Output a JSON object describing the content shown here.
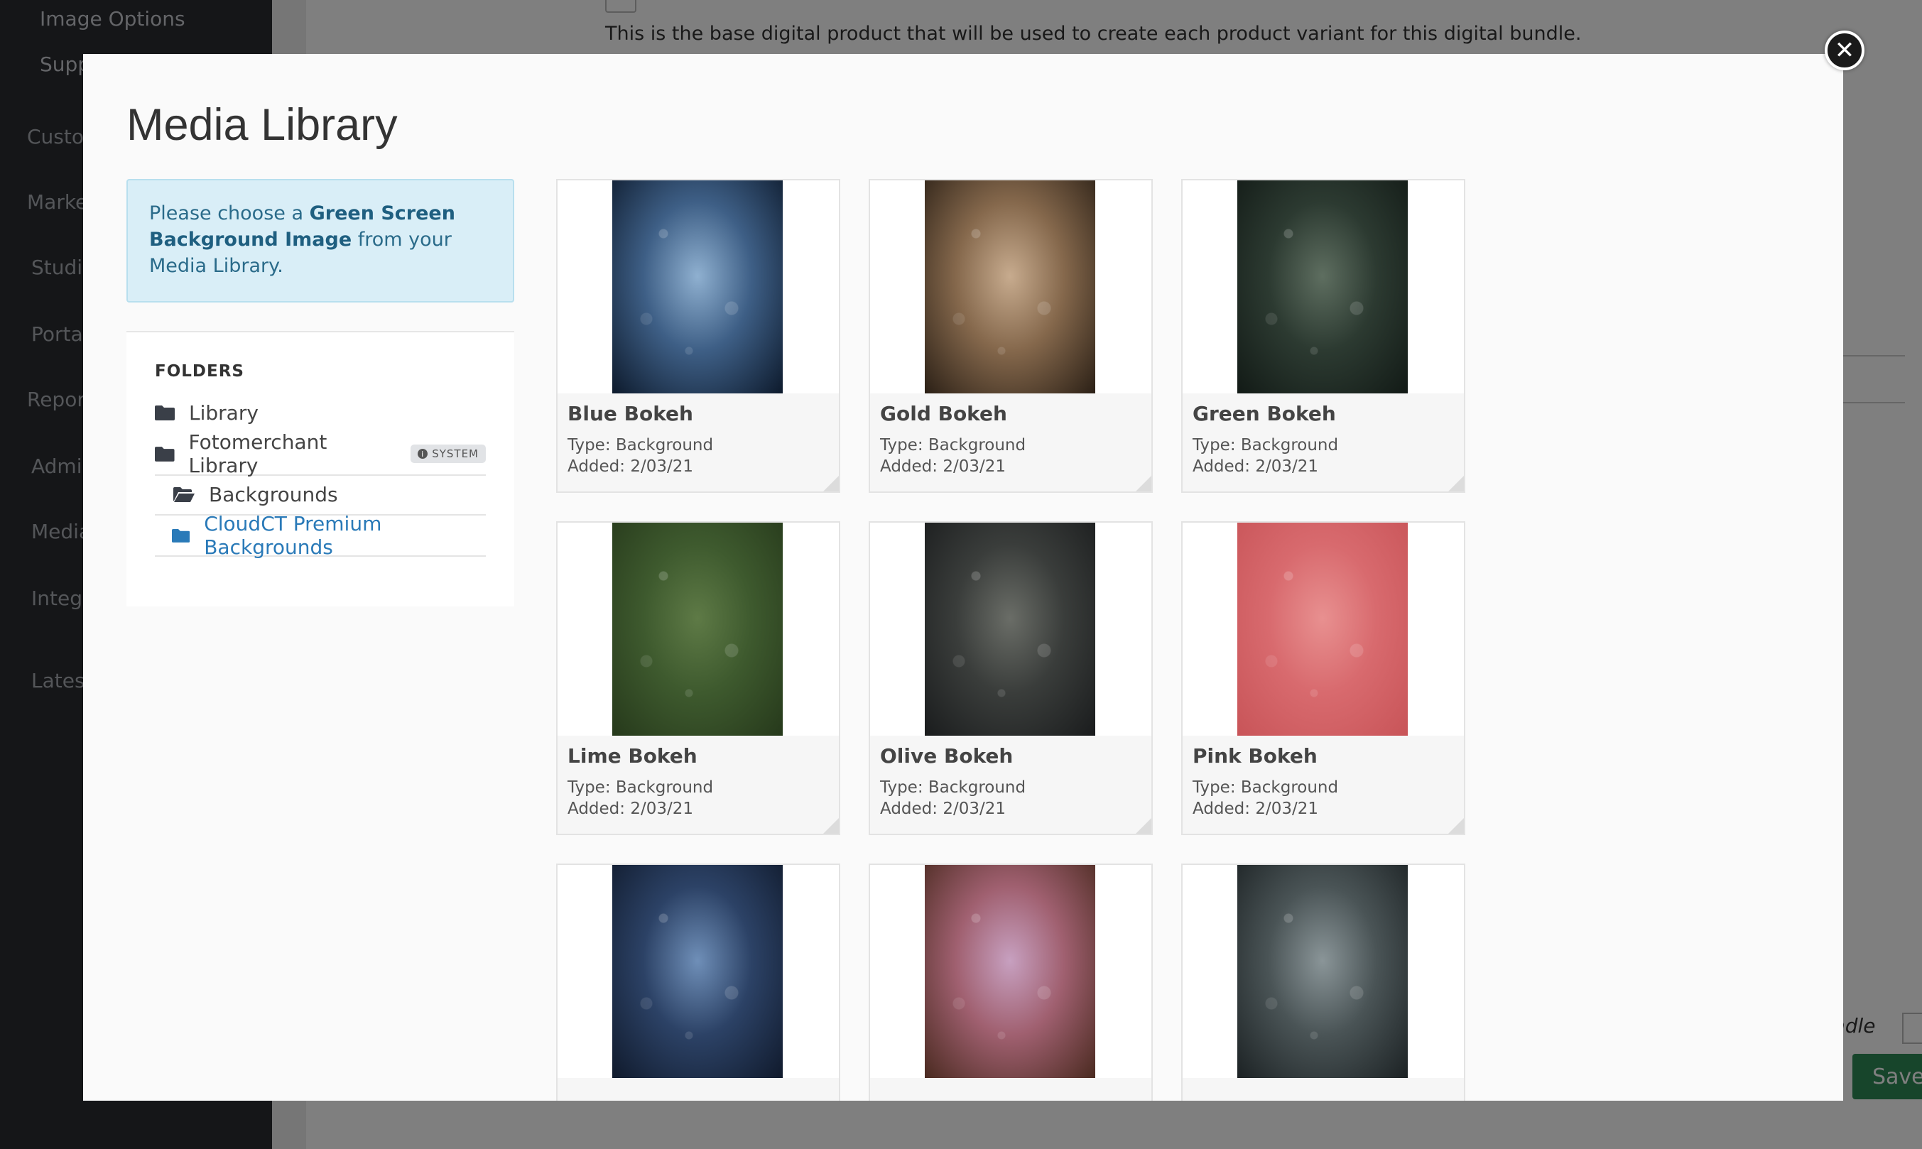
{
  "background_app": {
    "sidebar": {
      "sub_items": [
        "Image Options",
        "Supp"
      ],
      "items": [
        "Custo",
        "Marke",
        "Studi",
        "Porta",
        "Repor",
        "Admi",
        "Media",
        "Integ",
        "Lates"
      ]
    },
    "description": "This is the base digital product that will be used to create each product variant for this digital bundle.",
    "bundle_label": "ndle",
    "save_label": "Save"
  },
  "modal": {
    "title": "Media Library",
    "close_icon": "close-icon",
    "info": {
      "prefix": "Please choose a ",
      "bold": "Green Screen Background Image",
      "suffix": " from your Media Library."
    },
    "folders": {
      "heading": "FOLDERS",
      "items": [
        {
          "label": "Library",
          "icon": "folder-icon"
        },
        {
          "label": "Fotomerchant Library",
          "icon": "folder-icon",
          "badge": "SYSTEM"
        },
        {
          "label": "Backgrounds",
          "icon": "folder-open-icon"
        },
        {
          "label": "CloudCT Premium Backgrounds",
          "icon": "folder-icon",
          "active": true
        }
      ]
    },
    "media": [
      {
        "name": "Blue Bokeh",
        "type": "Type: Background",
        "added": "Added: 2/03/21",
        "colors": [
          "#8fb0d0",
          "#3e5f86",
          "#0d1a2c"
        ]
      },
      {
        "name": "Gold Bokeh",
        "type": "Type: Background",
        "added": "Added: 2/03/21",
        "colors": [
          "#c7ab8e",
          "#85684c",
          "#2b2016"
        ]
      },
      {
        "name": "Green Bokeh",
        "type": "Type: Background",
        "added": "Added: 2/03/21",
        "colors": [
          "#5e6e60",
          "#2c3a31",
          "#121a16"
        ]
      },
      {
        "name": "Lime Bokeh",
        "type": "Type: Background",
        "added": "Added: 2/03/21",
        "colors": [
          "#5e7a46",
          "#3e5a2e",
          "#26391b"
        ]
      },
      {
        "name": "Olive Bokeh",
        "type": "Type: Background",
        "added": "Added: 2/03/21",
        "colors": [
          "#6a6d67",
          "#3a3d3b",
          "#1a1c1d"
        ]
      },
      {
        "name": "Pink Bokeh",
        "type": "Type: Background",
        "added": "Added: 2/03/21",
        "colors": [
          "#e89090",
          "#d86a6e",
          "#c85458"
        ]
      },
      {
        "name": "",
        "type": "",
        "added": "",
        "colors": [
          "#6f8fb8",
          "#2c4266",
          "#101a2c"
        ]
      },
      {
        "name": "",
        "type": "",
        "added": "",
        "colors": [
          "#c7a0c0",
          "#a06070",
          "#4a2a20"
        ]
      },
      {
        "name": "",
        "type": "",
        "added": "",
        "colors": [
          "#8a9598",
          "#4a5456",
          "#1c2224"
        ]
      }
    ]
  }
}
